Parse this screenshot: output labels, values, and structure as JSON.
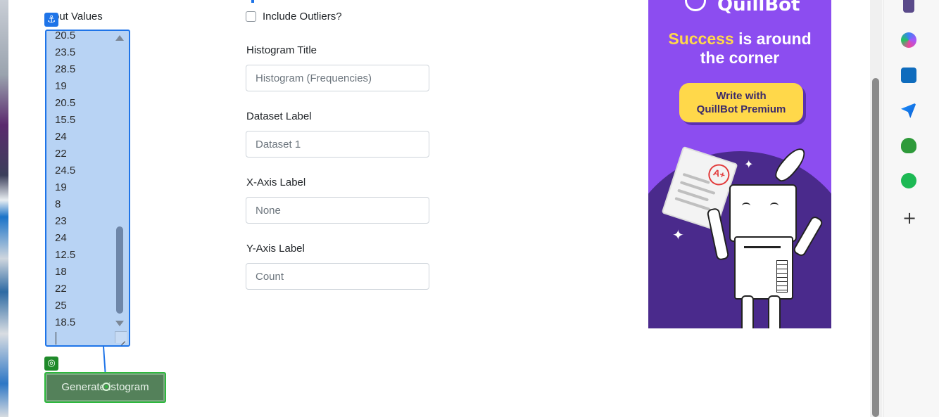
{
  "form": {
    "input_values_label": "Input Values",
    "input_values_visible_label": "out Values",
    "values": [
      "20.5",
      "23.5",
      "28.5",
      "19",
      "20.5",
      "15.5",
      "24",
      "22",
      "24.5",
      "19",
      "8",
      "23",
      "24",
      "12.5",
      "18",
      "22",
      "25",
      "18.5"
    ],
    "include_outliers_label": "Include Outliers?",
    "histogram_title_label": "Histogram Title",
    "histogram_title_placeholder": "Histogram (Frequencies)",
    "dataset_label_label": "Dataset Label",
    "dataset_label_placeholder": "Dataset 1",
    "x_axis_label_label": "X-Axis Label",
    "x_axis_label_placeholder": "None",
    "y_axis_label_label": "Y-Axis Label",
    "y_axis_label_placeholder": "Count",
    "generate_button_label": "Generate Histogram",
    "generate_button_visible": "Generate istogram"
  },
  "overlay": {
    "anchor_icon": "anchor-icon",
    "target_icon": "target-icon",
    "anchor_color": "#1e74e8",
    "target_color": "#1f8a2a"
  },
  "ad": {
    "brand": "QuillBot",
    "headline_highlight": "Success",
    "headline_rest_1": " is around",
    "headline_rest_2": "the corner",
    "cta_line1": "Write with",
    "cta_line2": "QuillBot Premium",
    "grade": "A+",
    "bg_color": "#8c4df0",
    "highlight_color": "#ffd84a"
  },
  "sidebar": {
    "icons": [
      "chess-icon",
      "copilot-icon",
      "outlook-icon",
      "send-icon",
      "tree-icon",
      "spotify-icon"
    ],
    "add_icon": "plus-icon"
  }
}
